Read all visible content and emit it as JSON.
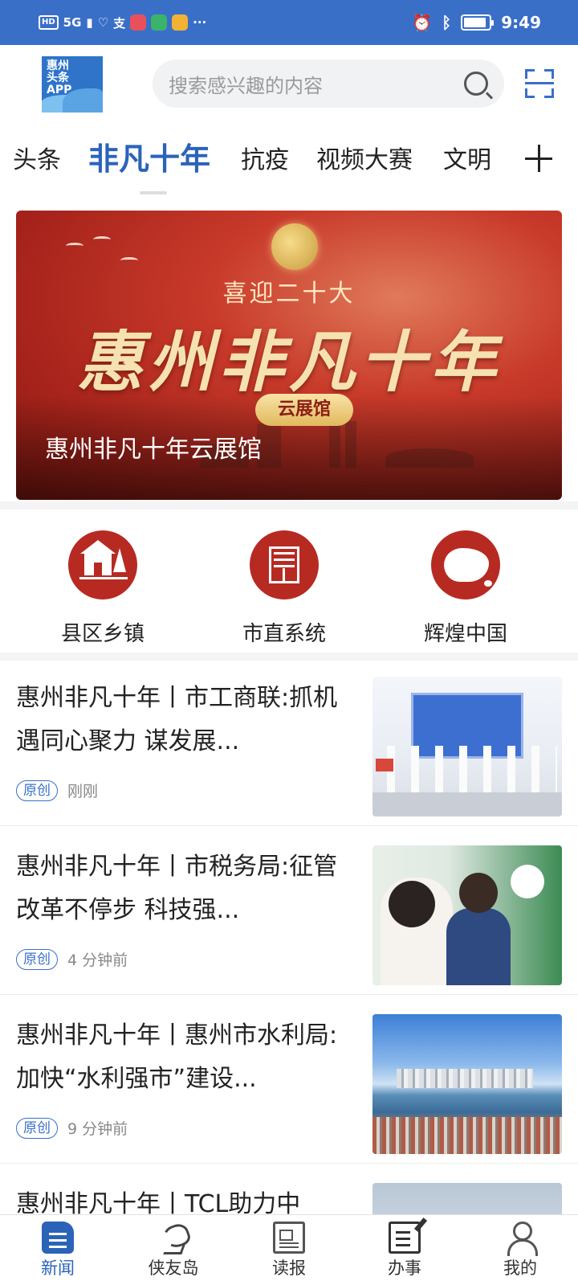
{
  "status_bar": {
    "network": "5G",
    "hd": "HD",
    "more": "···",
    "time": "9:49",
    "battery_level": 0.9
  },
  "header": {
    "logo_text": "惠州\n头条\nAPP",
    "search_placeholder": "搜索感兴趣的内容"
  },
  "tabs": [
    {
      "label": "头条",
      "active": false
    },
    {
      "label": "非凡十年",
      "active": true
    },
    {
      "label": "抗疫",
      "active": false
    },
    {
      "label": "视频大赛",
      "active": false
    },
    {
      "label": "文明",
      "active": false
    }
  ],
  "banner": {
    "subtitle": "喜迎二十大",
    "title": "惠州非凡十年",
    "pill": "云展馆",
    "caption": "惠州非凡十年云展馆",
    "colors": {
      "red": "#b72a22",
      "gold": "#f6e2b0"
    }
  },
  "quick_entries": [
    {
      "label": "县区乡镇",
      "icon": "house-tree-icon"
    },
    {
      "label": "市直系统",
      "icon": "gate-building-icon"
    },
    {
      "label": "辉煌中国",
      "icon": "china-map-icon"
    }
  ],
  "news": [
    {
      "title": "惠州非凡十年丨市工商联:抓机遇同心聚力 谋发展...",
      "tag": "原创",
      "time": "刚刚"
    },
    {
      "title": "惠州非凡十年丨市税务局:征管改革不停步 科技强...",
      "tag": "原创",
      "time": "4 分钟前"
    },
    {
      "title": "惠州非凡十年丨惠州市水利局:加快“水利强市”建设...",
      "tag": "原创",
      "time": "9 分钟前"
    },
    {
      "title": "惠州非凡十年丨TCL助力中",
      "tag": "",
      "time": ""
    }
  ],
  "bottom_nav": [
    {
      "label": "新闻",
      "icon": "news-icon",
      "active": true
    },
    {
      "label": "侠友岛",
      "icon": "island-icon",
      "active": false
    },
    {
      "label": "读报",
      "icon": "newspaper-icon",
      "active": false
    },
    {
      "label": "办事",
      "icon": "task-icon",
      "active": false
    },
    {
      "label": "我的",
      "icon": "user-icon",
      "active": false
    }
  ],
  "colors": {
    "accent": "#2b63b8",
    "status_bar": "#3a6fc8",
    "quick_icon_bg": "#b72a22"
  }
}
